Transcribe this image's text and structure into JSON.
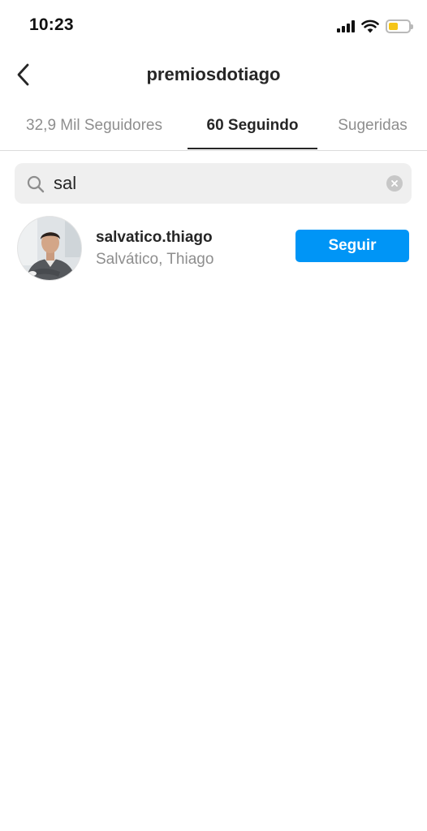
{
  "status_bar": {
    "time": "10:23",
    "icons": [
      "cellular-signal-icon",
      "wifi-icon",
      "battery-icon"
    ],
    "battery_color": "#f5c518"
  },
  "header": {
    "back_icon": "chevron-left-icon",
    "title": "premiosdotiago"
  },
  "tabs": [
    {
      "label": "32,9 Mil Seguidores",
      "active": false
    },
    {
      "label": "60 Seguindo",
      "active": true
    },
    {
      "label": "Sugeridas",
      "active": false
    }
  ],
  "search": {
    "icon": "search-icon",
    "value": "sal",
    "clear_icon": "clear-circle-icon"
  },
  "results": [
    {
      "username": "salvatico.thiago",
      "full_name": "Salvático, Thiago",
      "button_label": "Seguir"
    }
  ],
  "colors": {
    "accent": "#0095f6",
    "text_primary": "#262626",
    "text_secondary": "#8e8e8e",
    "search_bg": "#efefef"
  }
}
